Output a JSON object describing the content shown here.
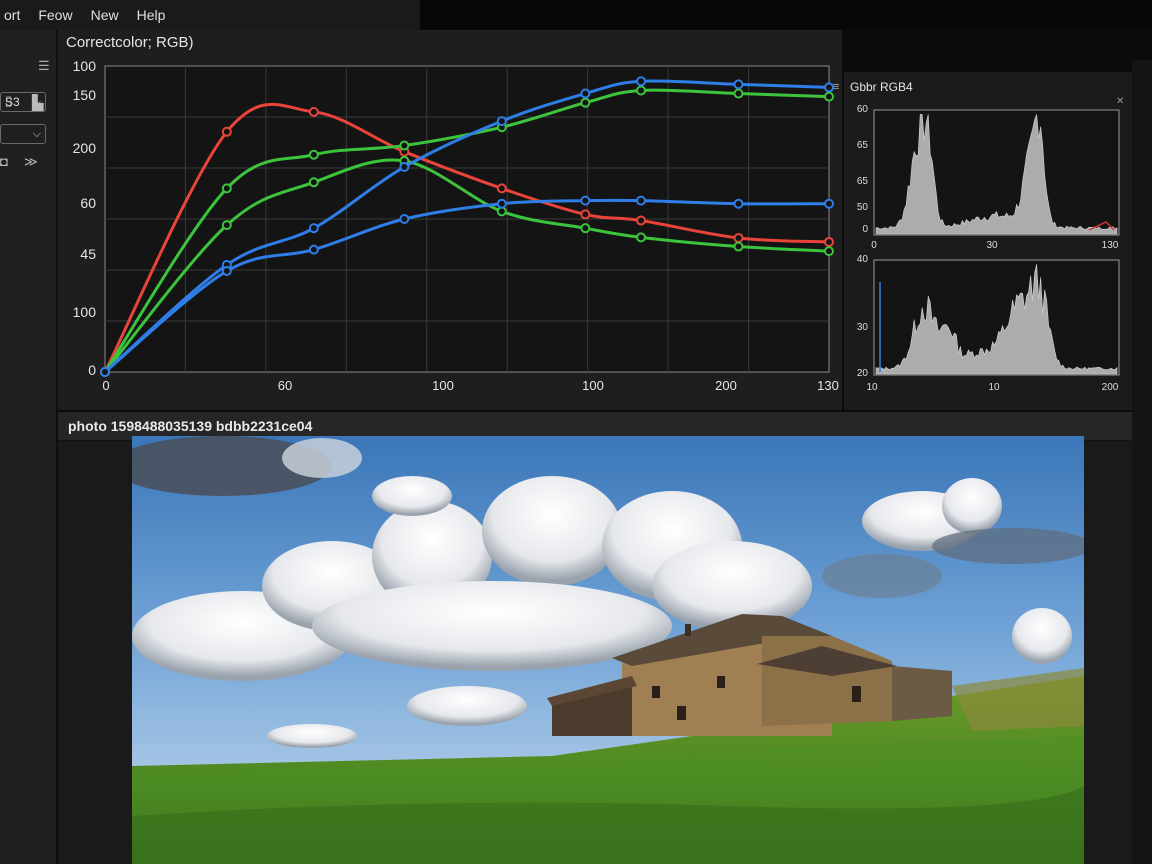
{
  "menu": [
    "ort",
    "Feow",
    "New",
    "Help"
  ],
  "left_toolbar": {
    "select1_value": "S3",
    "select2_value": ""
  },
  "curves": {
    "title": "Correctcolor; RGB)",
    "y_tick_labels": [
      "100",
      "150",
      "200",
      "60",
      "45",
      "100",
      "0"
    ],
    "x_tick_labels": [
      "0",
      "60",
      "100",
      "100",
      "200",
      "130"
    ],
    "series": [
      {
        "color": "#e8443a",
        "points": [
          [
            0,
            0
          ],
          [
            1.75,
            0.785
          ],
          [
            3.0,
            0.85
          ],
          [
            4.3,
            0.72
          ],
          [
            5.7,
            0.6
          ],
          [
            6.9,
            0.515
          ],
          [
            7.7,
            0.495
          ],
          [
            9.1,
            0.438
          ],
          [
            10.4,
            0.425
          ]
        ]
      },
      {
        "color": "#3cc43c",
        "points": [
          [
            0,
            0
          ],
          [
            1.75,
            0.48
          ],
          [
            3.0,
            0.62
          ],
          [
            4.3,
            0.69
          ],
          [
            5.7,
            0.525
          ],
          [
            6.9,
            0.47
          ],
          [
            7.7,
            0.44
          ],
          [
            9.1,
            0.41
          ],
          [
            10.4,
            0.395
          ]
        ]
      },
      {
        "color": "#3cc43c",
        "points": [
          [
            0,
            0
          ],
          [
            1.75,
            0.6
          ],
          [
            3.0,
            0.71
          ],
          [
            4.3,
            0.74
          ],
          [
            5.7,
            0.8
          ],
          [
            6.9,
            0.88
          ],
          [
            7.7,
            0.92
          ],
          [
            9.1,
            0.91
          ],
          [
            10.4,
            0.9
          ]
        ]
      },
      {
        "color": "#2f7de6",
        "points": [
          [
            0,
            0
          ],
          [
            1.75,
            0.35
          ],
          [
            3.0,
            0.47
          ],
          [
            4.3,
            0.67
          ],
          [
            5.7,
            0.82
          ],
          [
            6.9,
            0.91
          ],
          [
            7.7,
            0.95
          ],
          [
            9.1,
            0.94
          ],
          [
            10.4,
            0.93
          ]
        ]
      },
      {
        "color": "#2f7de6",
        "points": [
          [
            0,
            0
          ],
          [
            1.75,
            0.33
          ],
          [
            3.0,
            0.4
          ],
          [
            4.3,
            0.5
          ],
          [
            5.7,
            0.55
          ],
          [
            6.9,
            0.56
          ],
          [
            7.7,
            0.56
          ],
          [
            9.1,
            0.55
          ],
          [
            10.4,
            0.55
          ]
        ]
      }
    ]
  },
  "histograms": {
    "title": "Gbbr RGB4",
    "top": {
      "y_tick_labels": [
        "60",
        "65",
        "65",
        "50",
        "0"
      ],
      "x_tick_labels": [
        "0",
        "30",
        "130"
      ]
    },
    "bottom": {
      "y_tick_labels": [
        "40",
        "30",
        "20"
      ],
      "x_tick_labels": [
        "10",
        "10",
        "200"
      ]
    }
  },
  "photo": {
    "title": "photo 1598488035139 bdbb2231ce04"
  }
}
